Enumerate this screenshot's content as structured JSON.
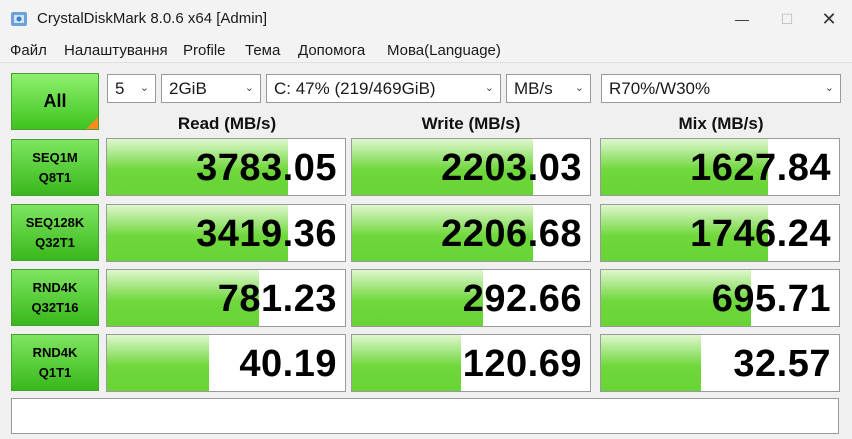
{
  "window": {
    "title": "CrystalDiskMark 8.0.6 x64 [Admin]"
  },
  "menu": [
    "Файл",
    "Налаштування",
    "Profile",
    "Тема",
    "Допомога",
    "Мова(Language)"
  ],
  "controls": {
    "all_label": "All",
    "count": "5",
    "size": "2GiB",
    "drive": "C: 47% (219/469GiB)",
    "unit": "MB/s",
    "mix": "R70%/W30%"
  },
  "headers": {
    "read": "Read (MB/s)",
    "write": "Write (MB/s)",
    "mix": "Mix (MB/s)"
  },
  "rows": [
    {
      "line1": "SEQ1M",
      "line2": "Q8T1",
      "read": "3783.05",
      "write": "2203.03",
      "mix": "1627.84",
      "read_fill": 0.76,
      "write_fill": 0.76,
      "mix_fill": 0.7
    },
    {
      "line1": "SEQ128K",
      "line2": "Q32T1",
      "read": "3419.36",
      "write": "2206.68",
      "mix": "1746.24",
      "read_fill": 0.76,
      "write_fill": 0.76,
      "mix_fill": 0.7
    },
    {
      "line1": "RND4K",
      "line2": "Q32T16",
      "read": "781.23",
      "write": "292.66",
      "mix": "695.71",
      "read_fill": 0.64,
      "write_fill": 0.55,
      "mix_fill": 0.63
    },
    {
      "line1": "RND4K",
      "line2": "Q1T1",
      "read": "40.19",
      "write": "120.69",
      "mix": "32.57",
      "read_fill": 0.43,
      "write_fill": 0.46,
      "mix_fill": 0.42
    }
  ],
  "comment": ""
}
